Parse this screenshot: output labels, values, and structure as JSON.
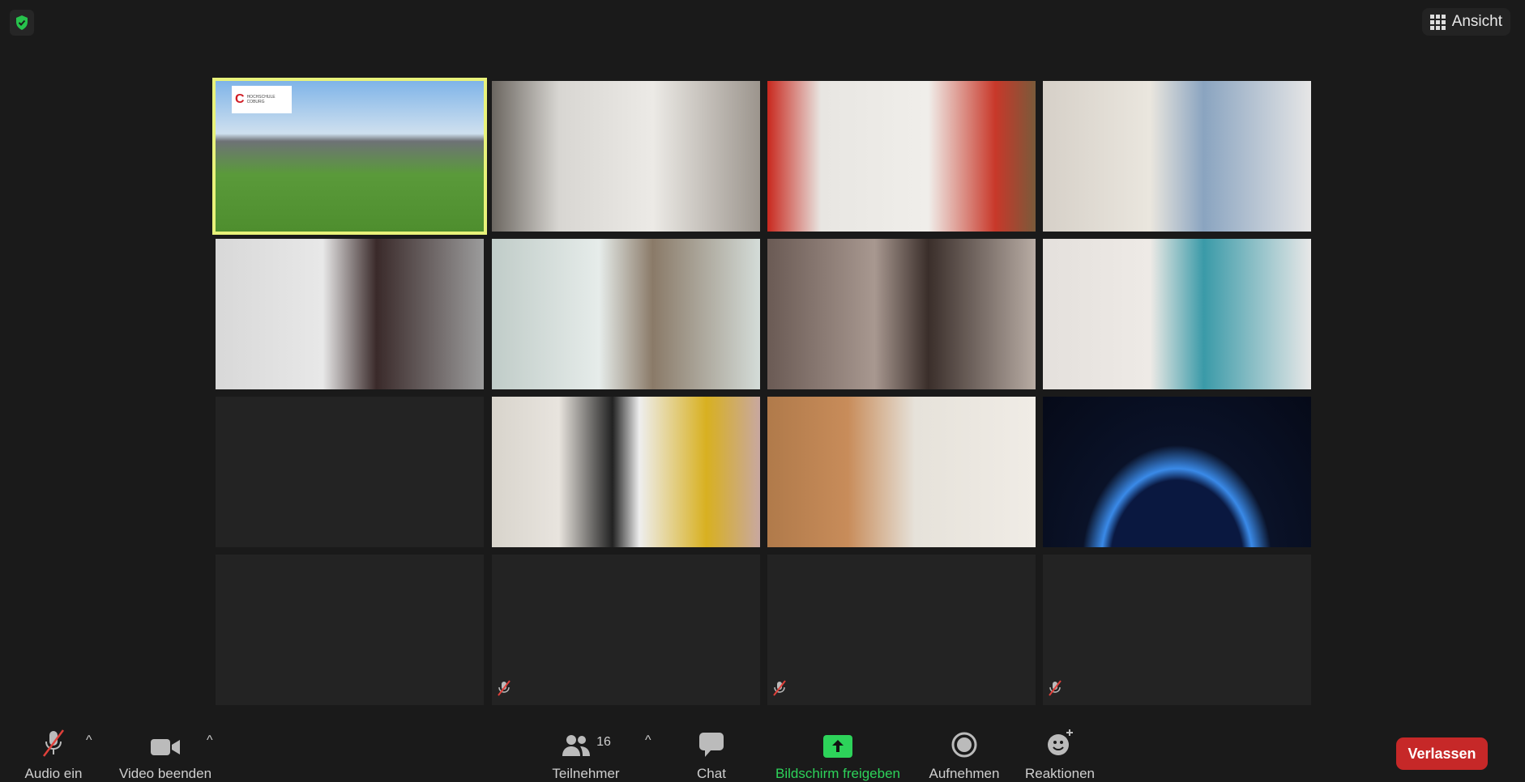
{
  "header": {
    "view_label": "Ansicht",
    "security_icon": "shield-check-icon",
    "view_icon": "grid-icon"
  },
  "tiles": [
    {
      "bg": "linear-gradient(180deg,#7fb4e8 0%,#cfe0ef 35%,#6e7276 40%,#5a9a3a 62%,#4e8e2e 100%)",
      "active": true,
      "logo": "HOCHSCHULE COBURG"
    },
    {
      "bg": "linear-gradient(90deg,#6b6660 0%,#d8d6d2 25%,#eceae6 60%,#9c958d 100%)"
    },
    {
      "bg": "linear-gradient(90deg,#c8281e 0%,#e8e6e2 20%,#f0eeea 60%,#c8382a 85%,#7a5a3a 100%)"
    },
    {
      "bg": "linear-gradient(90deg,#d6d0c8 0%,#eae6de 40%,#8aa4c0 60%,#e6e6e6 100%)"
    },
    {
      "bg": "linear-gradient(90deg,#d8d8d8 0%,#e8e8e8 40%,#3a2a2a 60%,#9c9c9c 100%)"
    },
    {
      "bg": "linear-gradient(90deg,#c0ccc8 0%,#e6ecea 40%,#8a7a68 60%,#d4dcd8 100%)"
    },
    {
      "bg": "linear-gradient(90deg,#6a5a54 0%,#a89890 40%,#3a2e2a 60%,#b8aca4 100%)"
    },
    {
      "bg": "linear-gradient(90deg,#e4e0dc 0%,#eeeae6 40%,#3a9aa8 60%,#e8e8e8 100%)"
    },
    {
      "bg": "#232323"
    },
    {
      "bg": "linear-gradient(90deg,#d8d4cc 0%,#e8e4de 25%,#222 45%,#eee 55%,#d8b020 80%,#c8a8a0 100%)"
    },
    {
      "bg": "linear-gradient(90deg,#b07a4a 0%,#c88c5a 30%,#e6e2da 55%,#f0ece6 100%)"
    },
    {
      "bg": "radial-gradient(ellipse at 50% 110%,#0a1840 35%,#3a8ae8 40%,#0a1228 50%,#060a18 100%)"
    },
    {
      "bg": "#232323"
    },
    {
      "bg": "#232323",
      "muted": true
    },
    {
      "bg": "#232323",
      "muted": true
    },
    {
      "bg": "#232323",
      "muted": true
    }
  ],
  "toolbar": {
    "audio": {
      "label": "Audio ein",
      "icon": "mic-muted-icon"
    },
    "video": {
      "label": "Video beenden",
      "icon": "video-camera-icon"
    },
    "participants": {
      "label": "Teilnehmer",
      "count": "16",
      "icon": "participants-icon"
    },
    "chat": {
      "label": "Chat",
      "icon": "chat-icon"
    },
    "share": {
      "label": "Bildschirm freigeben",
      "icon": "share-screen-icon",
      "color": "#2dd35a"
    },
    "record": {
      "label": "Aufnehmen",
      "icon": "record-icon"
    },
    "reactions": {
      "label": "Reaktionen",
      "icon": "emoji-add-icon"
    },
    "leave": {
      "label": "Verlassen",
      "color": "#c62828"
    }
  }
}
